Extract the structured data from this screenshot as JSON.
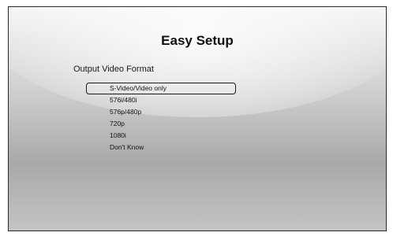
{
  "screen": {
    "title": "Easy Setup",
    "subtitle": "Output Video Format"
  },
  "options": [
    {
      "label": "S-Video/Video only",
      "selected": true
    },
    {
      "label": "576i/480i",
      "selected": false
    },
    {
      "label": "576p/480p",
      "selected": false
    },
    {
      "label": "720p",
      "selected": false
    },
    {
      "label": "1080i",
      "selected": false
    },
    {
      "label": "Don't Know",
      "selected": false
    }
  ],
  "colors": {
    "text": "#111111",
    "frame": "#2a2a2a"
  }
}
